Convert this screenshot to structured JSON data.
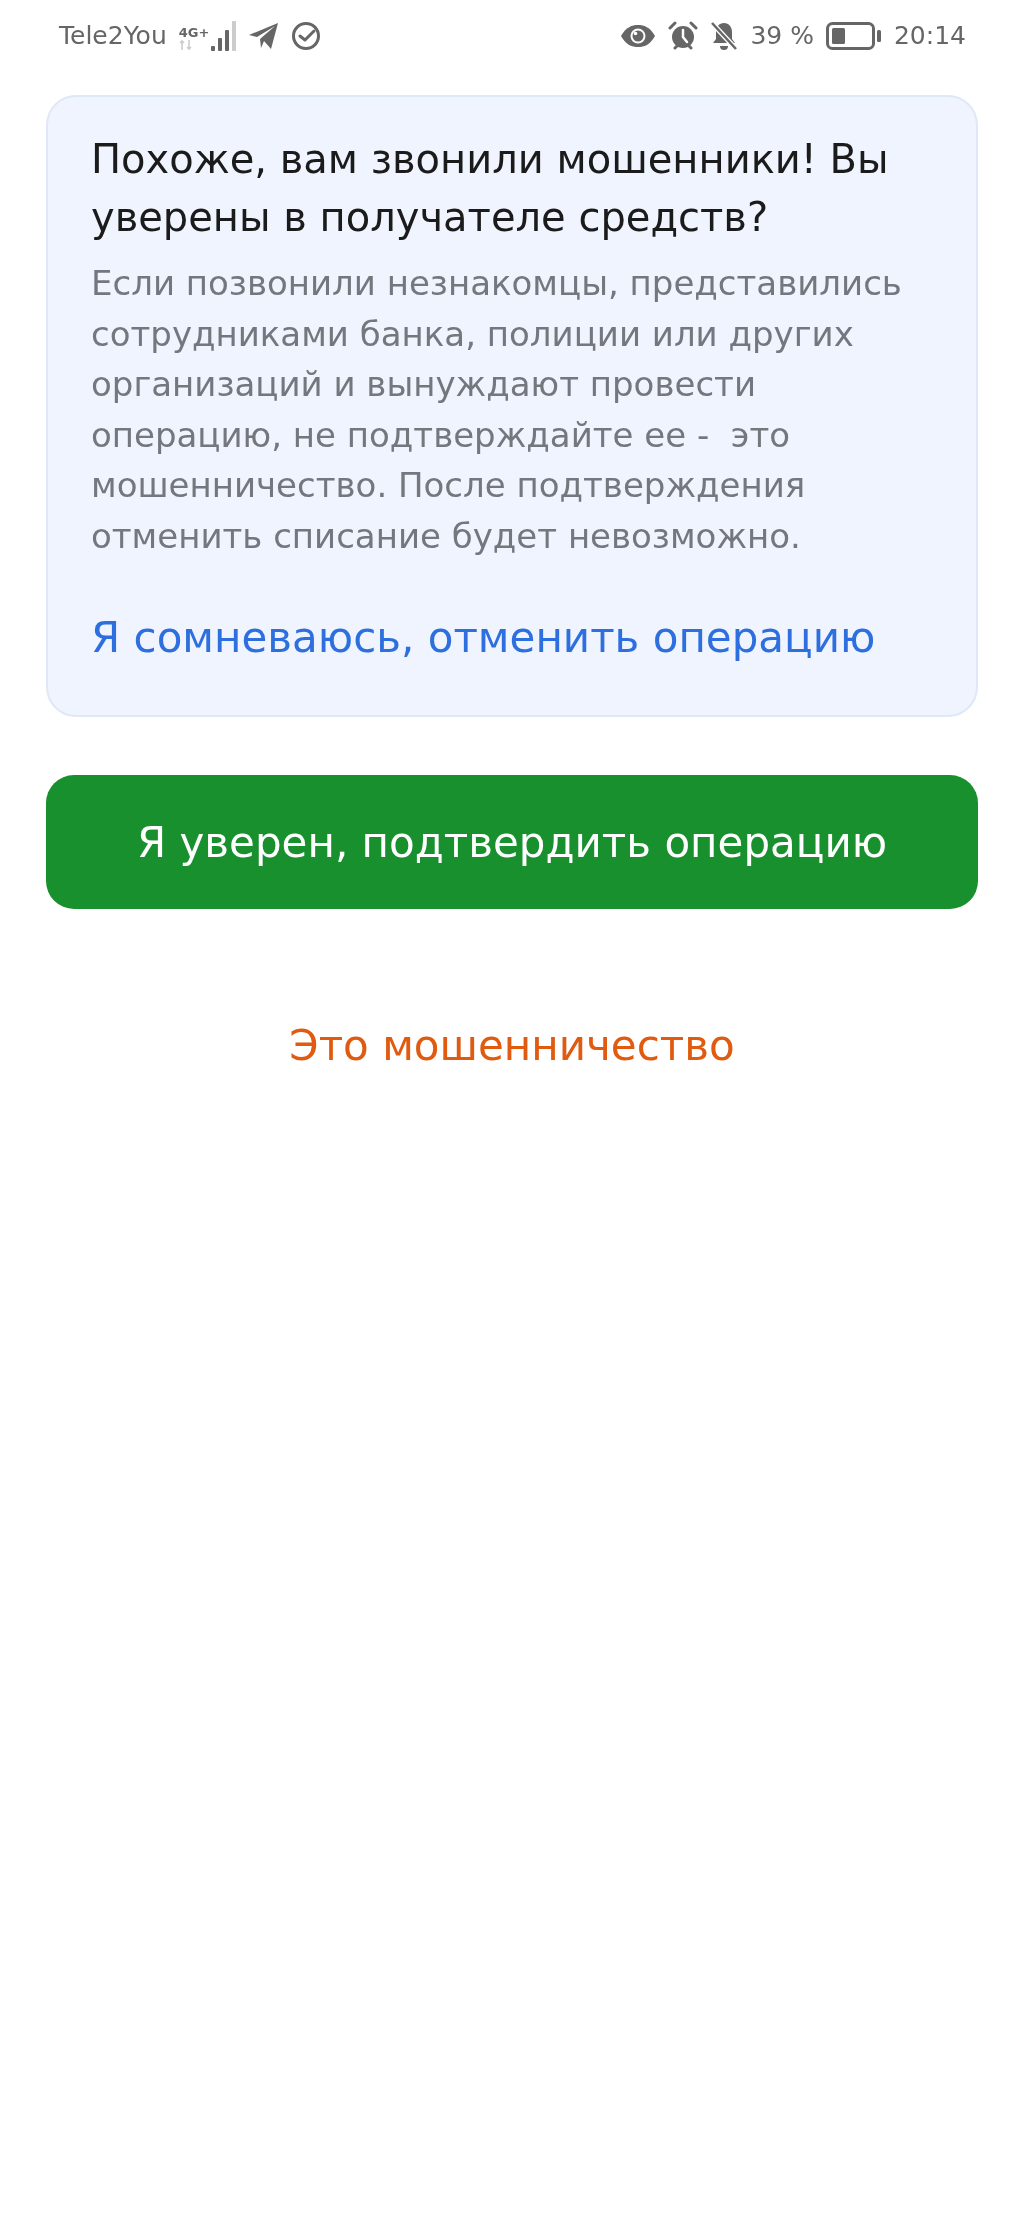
{
  "status_bar": {
    "carrier": "Tele2You",
    "network": "4G+",
    "battery": "39 %",
    "time": "20:14"
  },
  "alert": {
    "title": "Похоже, вам звонили мошенники! Вы уверены в получателе средств?",
    "body": "Если позвонили незнакомцы, представились сотрудниками банка, полиции или других организаций и вынуждают провести операцию, не подтверждайте ее -  это мошенничество. После подтверждения отменить списание будет невозможно.",
    "link": "Я сомневаюсь, отменить операцию"
  },
  "actions": [
    {
      "kind": "primary",
      "label": "Я уверен, подтвердить операцию"
    },
    {
      "kind": "danger_link",
      "label": "Это мошенничество"
    }
  ]
}
